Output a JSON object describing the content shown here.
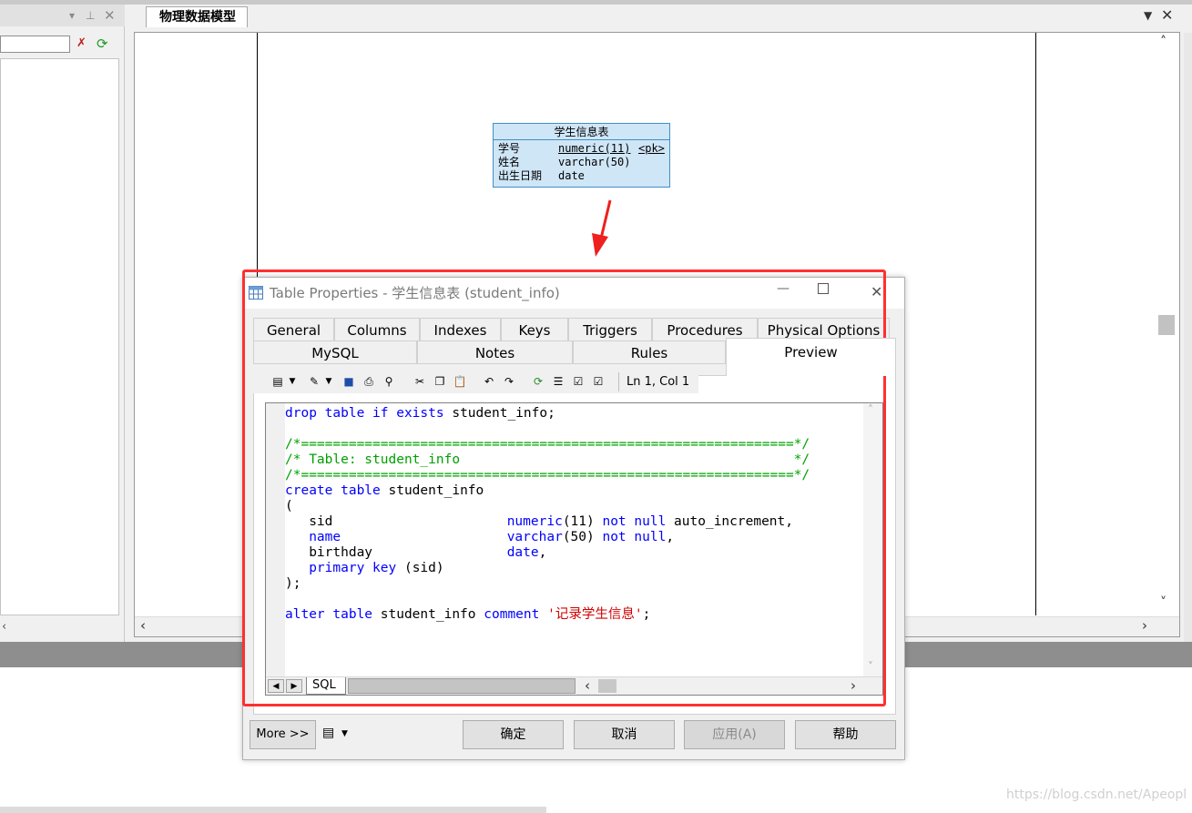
{
  "left_panel": {
    "search_value": ""
  },
  "model_tab": {
    "label": "物理数据模型"
  },
  "entity": {
    "title": "学生信息表",
    "rows": [
      {
        "name": "学号",
        "type": "numeric(11)",
        "key": "<pk>"
      },
      {
        "name": "姓名",
        "type": "varchar(50)",
        "key": ""
      },
      {
        "name": "出生日期",
        "type": "date",
        "key": ""
      }
    ]
  },
  "dialog": {
    "title": "Table Properties - 学生信息表 (student_info)",
    "tabs_row1": [
      "General",
      "Columns",
      "Indexes",
      "Keys",
      "Triggers",
      "Procedures",
      "Physical Options"
    ],
    "tabs_row2": [
      "MySQL",
      "Notes",
      "Rules",
      "Preview"
    ],
    "active_tab": "Preview",
    "status": "Ln 1, Col 1",
    "editor_tab": "SQL",
    "buttons": {
      "more": "More >>",
      "ok": "确定",
      "cancel": "取消",
      "apply": "应用(A)",
      "help": "帮助"
    }
  },
  "sql": {
    "line1": "drop table if exists student_info;",
    "line3": "/*==============================================================*/",
    "line4": "/* Table: student_info                                          */",
    "line5": "/*==============================================================*/",
    "line6": "create table student_info",
    "line7": "(",
    "line8_name": "sid",
    "line8_type": "numeric(11)",
    "line8_rest": "not null auto_increment,",
    "line9_name": "name",
    "line9_type": "varchar(50)",
    "line9_rest": "not null,",
    "line10_name": "birthday",
    "line10_type": "date,",
    "line11": "primary key (sid)",
    "line12": ");",
    "line14_a": "alter table student_info",
    "line14_b": "comment",
    "line14_str": "'记录学生信息'",
    "line14_end": ";"
  },
  "watermark": "https://blog.csdn.net/Apeopl",
  "colors": {
    "highlight": "#ff3030",
    "keyword": "#0000ff",
    "comment": "#00a000",
    "string": "#d00000"
  }
}
